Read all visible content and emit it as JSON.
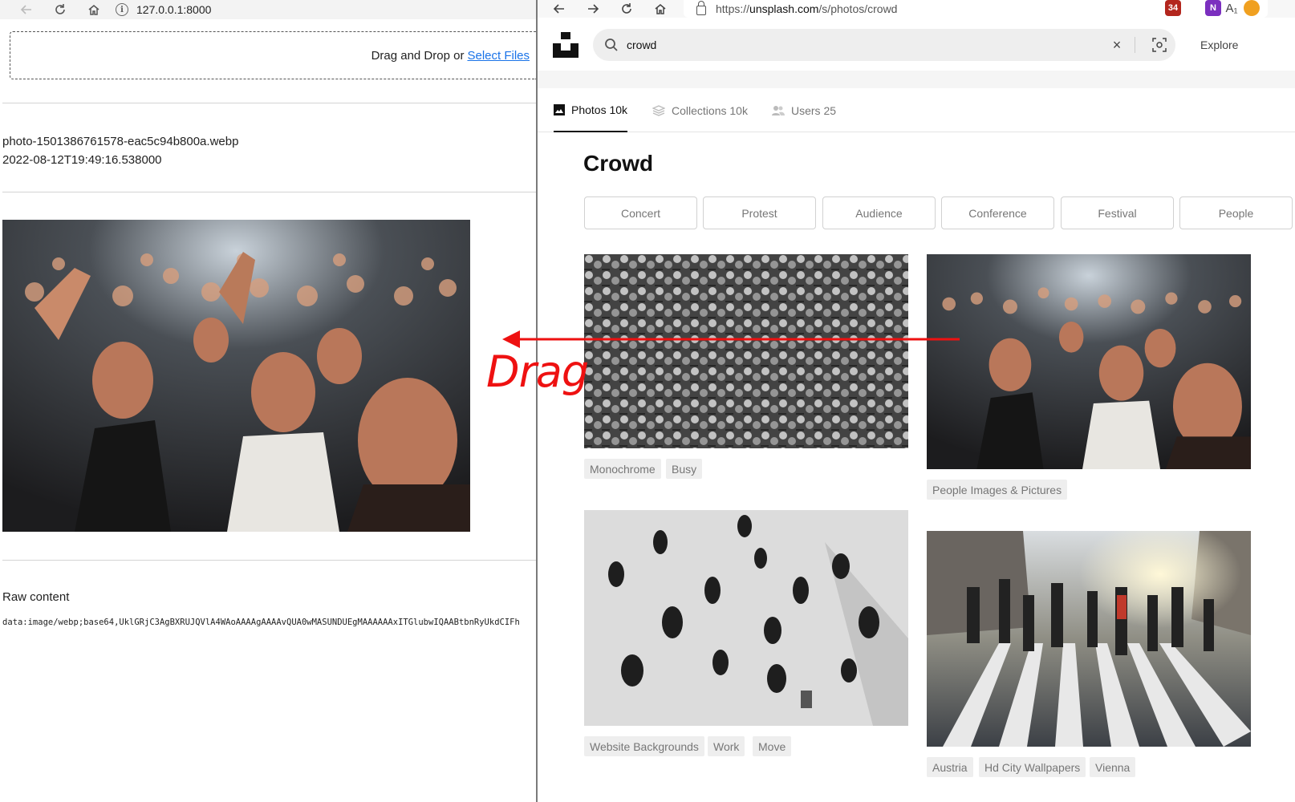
{
  "left_browser": {
    "url": "127.0.0.1:8000",
    "dropzone": {
      "text": "Drag and Drop or",
      "link": "Select Files"
    },
    "file": {
      "name": "photo-1501386761578-eac5c94b800a.webp",
      "timestamp": "2022-08-12T19:49:16.538000"
    },
    "raw": {
      "title": "Raw content",
      "data": "data:image/webp;base64,UklGRjC3AgBXRUJQVlA4WAoAAAAgAAAAvQUA0wMASUNDUEgMAAAAAAxITGlubwIQAABtbnRyUkdCIFh"
    }
  },
  "right_browser": {
    "url_prefix": "https://",
    "url_host": "unsplash.com",
    "url_path": "/s/photos/crowd",
    "extension_badge": "34",
    "search_value": "crowd",
    "explore": "Explore",
    "tabs": [
      {
        "label": "Photos 10k",
        "icon": "image-icon",
        "active": true
      },
      {
        "label": "Collections 10k",
        "icon": "layers-icon",
        "active": false
      },
      {
        "label": "Users 25",
        "icon": "users-icon",
        "active": false
      }
    ],
    "heading": "Crowd",
    "chips": [
      "Concert",
      "Protest",
      "Audience",
      "Conference",
      "Festival",
      "People"
    ],
    "photos": [
      {
        "tags": [
          "Monochrome",
          "Busy"
        ]
      },
      {
        "tags": [
          "People Images & Pictures"
        ]
      },
      {
        "tags": [
          "Website Backgrounds",
          "Work",
          "Move"
        ]
      },
      {
        "tags": [
          "Austria",
          "Hd City Wallpapers",
          "Vienna"
        ]
      }
    ]
  },
  "annotation": {
    "label": "Drag",
    "color": "#ee1111"
  },
  "colors": {
    "link": "#1a73e8",
    "accent_red": "#ee1111"
  }
}
